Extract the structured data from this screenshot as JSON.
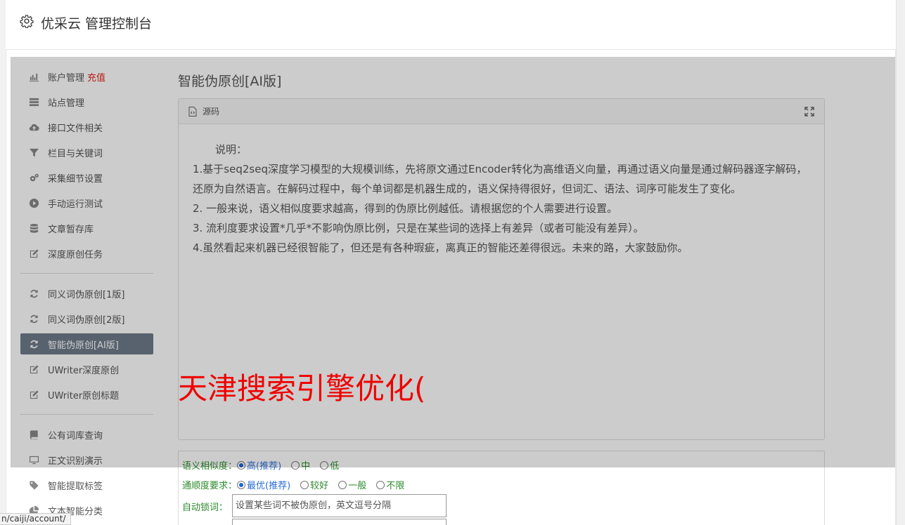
{
  "header": {
    "title": "优采云 管理控制台",
    "icon": "gear-icon"
  },
  "sidebar": {
    "groups": [
      [
        {
          "label": "账户管理",
          "extra": "充值",
          "icon": "bar-chart-icon"
        },
        {
          "label": "站点管理",
          "icon": "server-icon"
        },
        {
          "label": "接口文件相关",
          "icon": "cloud-upload-icon"
        },
        {
          "label": "栏目与关键词",
          "icon": "filter-icon"
        },
        {
          "label": "采集细节设置",
          "icon": "gears-icon"
        },
        {
          "label": "手动运行测试",
          "icon": "play-icon"
        },
        {
          "label": "文章暂存库",
          "icon": "database-icon"
        },
        {
          "label": "深度原创任务",
          "icon": "edit-icon"
        }
      ],
      [
        {
          "label": "同义词伪原创[1版]",
          "icon": "refresh-icon"
        },
        {
          "label": "同义词伪原创[2版]",
          "icon": "refresh-icon"
        },
        {
          "label": "智能伪原创[AI版]",
          "icon": "refresh-icon",
          "active": true
        },
        {
          "label": "UWriter深度原创",
          "icon": "edit-icon"
        },
        {
          "label": "UWriter原创标题",
          "icon": "edit-icon"
        }
      ],
      [
        {
          "label": "公有词库查询",
          "icon": "book-icon"
        },
        {
          "label": "正文识别演示",
          "icon": "monitor-icon"
        },
        {
          "label": "智能提取标签",
          "icon": "tag-icon"
        },
        {
          "label": "文本智能分类",
          "icon": "pie-chart-icon"
        }
      ]
    ]
  },
  "main": {
    "title": "智能伪原创[AI版]",
    "source_label": "源码",
    "description": {
      "heading": "说明：",
      "lines": [
        "1.基于seq2seq深度学习模型的大规模训练，先将原文通过Encoder转化为高维语义向量，再通过语义向量是通过解码器逐字解码，还原为自然语言。在解码过程中，每个单词都是机器生成的，语义保持得很好，但词汇、语法、词序可能发生了变化。",
        "2. 一般来说，语义相似度要求越高，得到的伪原比例越低。请根据您的个人需要进行设置。",
        "3. 流利度要求设置*几乎*不影响伪原比例，只是在某些词的选择上有差异（或者可能没有差异）。",
        "4.虽然看起来机器已经很智能了，但还是有各种瑕疵，离真正的智能还差得很远。未来的路，大家鼓励你。"
      ]
    },
    "watermark": "天津搜索引擎优化(",
    "options": {
      "similarity": {
        "label": "语义相似度：",
        "choices": [
          "高(推荐)",
          "中",
          "低"
        ],
        "selected": 0
      },
      "fluency": {
        "label": "通顺度要求：",
        "choices": [
          "最优(推荐)",
          "较好",
          "一般",
          "不限"
        ],
        "selected": 0
      },
      "lock": {
        "label": "自动锁词：",
        "placeholder": "设置某些词不被伪原创，英文逗号分隔"
      }
    }
  },
  "status_url": "n/caiji/account/"
}
